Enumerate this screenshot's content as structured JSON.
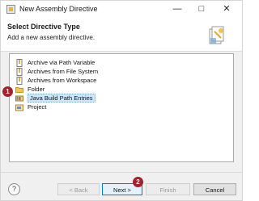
{
  "window": {
    "title": "New Assembly Directive",
    "controls": {
      "minimize": "—",
      "maximize": "□",
      "close": "✕"
    }
  },
  "banner": {
    "title": "Select Directive Type",
    "description": "Add a new assembly directive.",
    "icon": "wizard-icon"
  },
  "directive_types": [
    {
      "label": "Archive via Path Variable",
      "icon": "archive-icon"
    },
    {
      "label": "Archives from File System",
      "icon": "archive-icon"
    },
    {
      "label": "Archives from Workspace",
      "icon": "archive-icon"
    },
    {
      "label": "Folder",
      "icon": "folder-icon"
    },
    {
      "label": "Java Build Path Entries",
      "icon": "library-icon",
      "selected": true
    },
    {
      "label": "Project",
      "icon": "project-icon"
    }
  ],
  "callouts": {
    "one": "1",
    "two": "2"
  },
  "buttons": {
    "help": "?",
    "back": "< Back",
    "next": "Next >",
    "finish": "Finish",
    "cancel": "Cancel"
  },
  "colors": {
    "callout": "#a8202b",
    "selection": "#cce8ff",
    "primary_border": "#0078d7"
  }
}
